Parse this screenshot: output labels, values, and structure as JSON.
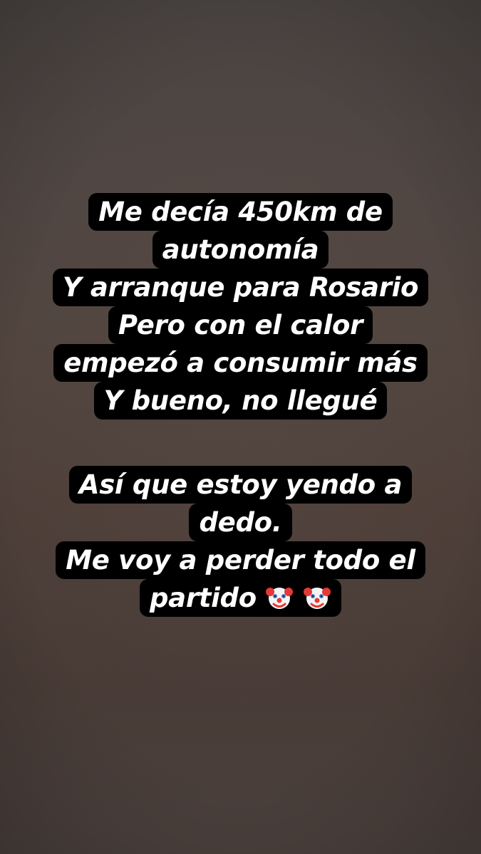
{
  "story": {
    "block1": [
      "Me decía 450km de",
      "autonomía",
      "Y arranque para Rosario",
      "Pero con el calor",
      "empezó a consumir más",
      "Y bueno, no llegué"
    ],
    "block2": [
      "Así que estoy yendo a",
      "dedo.",
      "Me voy a perder todo el",
      "partido"
    ],
    "emoji": "🤡🤡"
  },
  "colors": {
    "caption_bg": "#000000",
    "caption_text": "#ffffff",
    "background": "#4d423e"
  }
}
